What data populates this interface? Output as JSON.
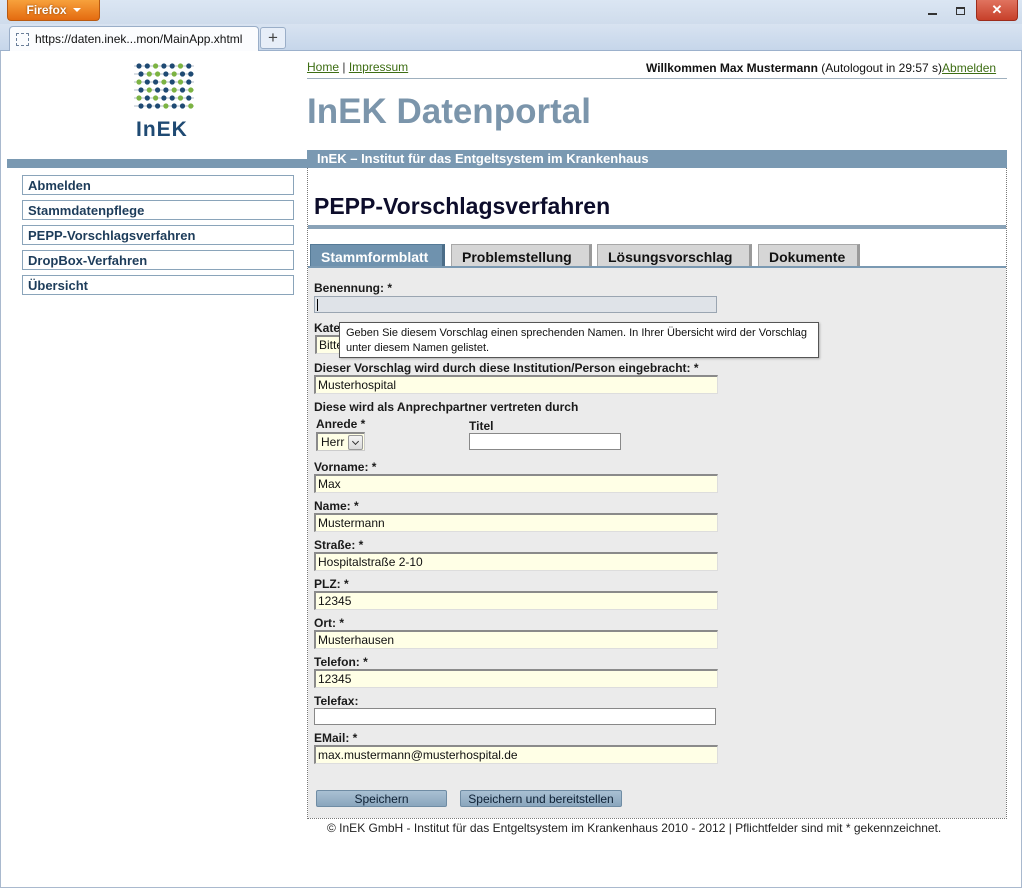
{
  "browser": {
    "app_button": "Firefox",
    "tab_title": "https://daten.inek...mon/MainApp.xhtml",
    "new_tab": "+",
    "close_symbol": "✕"
  },
  "header": {
    "logo_text": "InEK",
    "links": {
      "home": "Home",
      "separator": "|",
      "impressum": "Impressum"
    },
    "welcome_prefix": "Willkommen Max Mustermann",
    "autologout": "(Autologout in   29:57 s)",
    "logout_link": "Abmelden",
    "portal_title": "InEK Datenportal",
    "institute_bar": "InEK – Institut für das Entgeltsystem im Krankenhaus"
  },
  "sidebar": {
    "items": [
      {
        "label": "Abmelden"
      },
      {
        "label": "Stammdatenpflege"
      },
      {
        "label": "PEPP-Vorschlagsverfahren"
      },
      {
        "label": "DropBox-Verfahren"
      },
      {
        "label": "Übersicht"
      }
    ]
  },
  "main": {
    "heading": "PEPP-Vorschlagsverfahren",
    "tabs": [
      {
        "label": "Stammformblatt",
        "active": true
      },
      {
        "label": "Problemstellung",
        "active": false
      },
      {
        "label": "Lösungsvorschlag",
        "active": false
      },
      {
        "label": "Dokumente",
        "active": false
      }
    ],
    "tooltip": "Geben Sie diesem Vorschlag einen sprechenden Namen. In Ihrer Übersicht wird der Vorschlag unter diesem Namen gelistet.",
    "form": {
      "benennung_label": "Benennung: *",
      "benennung_value": "",
      "kategorie_label": "Kate",
      "kategorie_value": "Bitte",
      "institution_label": "Dieser Vorschlag wird durch diese Institution/Person eingebracht: *",
      "institution_value": "Musterhospital",
      "contact_heading": "Diese wird als Anprechpartner vertreten durch",
      "anrede_label": "Anrede *",
      "anrede_value": "Herr",
      "titel_label": "Titel",
      "titel_value": "",
      "vorname_label": "Vorname: *",
      "vorname_value": "Max",
      "name_label": "Name: *",
      "name_value": "Mustermann",
      "strasse_label": "Straße: *",
      "strasse_value": "Hospitalstraße 2-10",
      "plz_label": "PLZ: *",
      "plz_value": "12345",
      "ort_label": "Ort: *",
      "ort_value": "Musterhausen",
      "telefon_label": "Telefon: *",
      "telefon_value": "12345",
      "telefax_label": "Telefax:",
      "telefax_value": "",
      "email_label": "EMail: *",
      "email_value": "max.mustermann@musterhospital.de"
    },
    "buttons": {
      "save": "Speichern",
      "save_publish": "Speichern und bereitstellen"
    }
  },
  "footer": {
    "text": "© InEK GmbH - Institut für das Entgeltsystem im Krankenhaus 2010 - 2012 | Pflichtfelder sind mit * gekennzeichnet."
  },
  "colors": {
    "brand_blue": "#7a99b2",
    "title_blue": "#7b95ab",
    "link_green": "#3e6e14",
    "field_yellow": "#ffffe6",
    "firefox_orange": "#e46b10"
  }
}
